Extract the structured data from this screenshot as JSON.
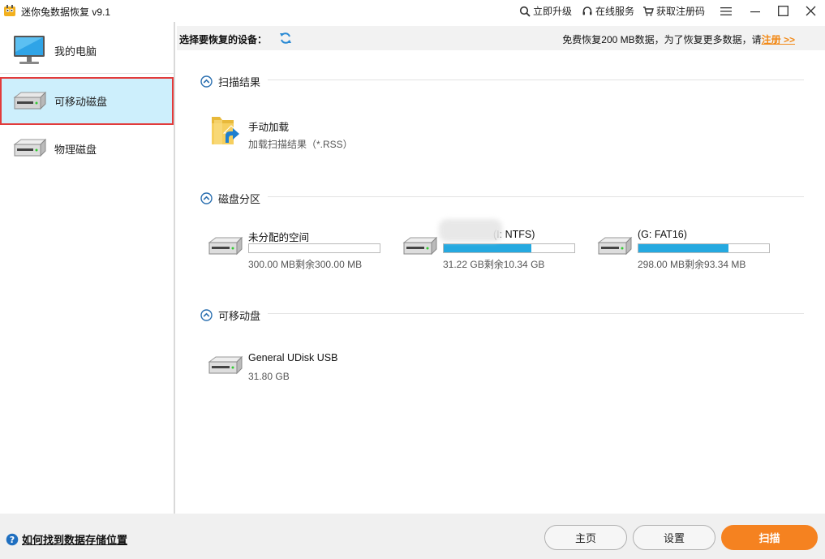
{
  "window": {
    "title": "迷你兔数据恢复 v9.1",
    "links": {
      "upgrade": "立即升级",
      "service": "在线服务",
      "register": "获取注册码"
    }
  },
  "sidebar": {
    "items": [
      {
        "label": "我的电脑",
        "icon": "monitor-icon"
      },
      {
        "label": "可移动磁盘",
        "icon": "removable-disk-icon",
        "selected": true
      },
      {
        "label": "物理磁盘",
        "icon": "physical-disk-icon"
      }
    ]
  },
  "header": {
    "title": "选择要恢复的设备：",
    "note": "免费恢复200 MB数据，为了恢复更多数据，请",
    "register_link": "注册 >>"
  },
  "sections": {
    "scan_results": {
      "title": "扫描结果",
      "item": {
        "name": "手动加载",
        "sub": "加载扫描结果（*.RSS）"
      }
    },
    "partitions": {
      "title": "磁盘分区",
      "items": [
        {
          "name": "未分配的空间",
          "usage": "300.00 MB剩余300.00 MB",
          "fill": 0
        },
        {
          "name": "(I: NTFS)",
          "usage": "31.22 GB剩余10.34 GB",
          "fill": 0.67
        },
        {
          "name": "(G: FAT16)",
          "usage": "298.00 MB剩余93.34 MB",
          "fill": 0.69
        }
      ]
    },
    "removable": {
      "title": "可移动盘",
      "item": {
        "name": "General UDisk USB",
        "size": "31.80 GB"
      }
    }
  },
  "footer": {
    "help": "如何找到数据存储位置",
    "home": "主页",
    "settings": "设置",
    "scan": "扫描"
  },
  "colors": {
    "accent": "#f58220",
    "selected_bg": "#cdeffc",
    "selected_border": "#e23b3b",
    "bar_fill": "#25a9e0"
  }
}
